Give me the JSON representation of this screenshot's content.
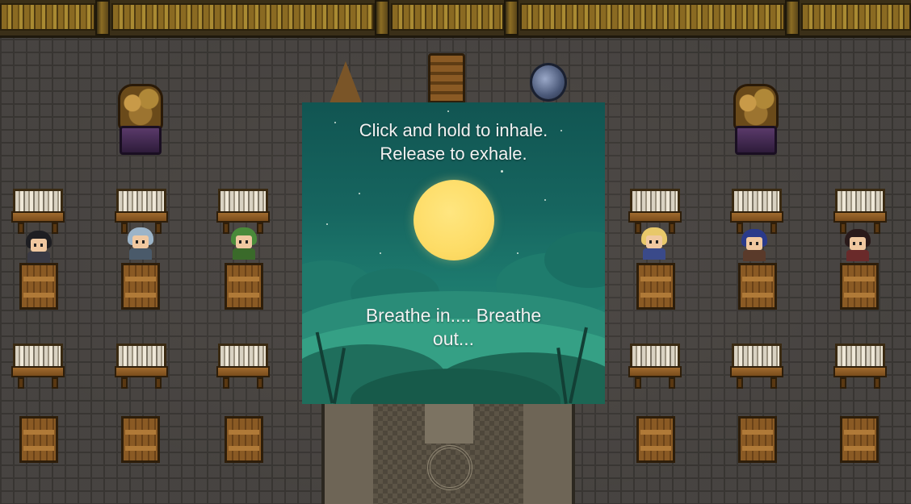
{
  "scene": {
    "name": "classroom",
    "colors": {
      "floor": "#4b4744",
      "wall_gold": "#8a6a22",
      "popup_top": "#115552",
      "popup_bottom": "#289078",
      "moon": "#fddc66",
      "text": "#f2f2f2"
    }
  },
  "breathing_popup": {
    "instruction_line1": "Click and hold to inhale.",
    "instruction_line2": "Release to exhale.",
    "status": "Breathe in.... Breathe out..."
  },
  "students": [
    {
      "name": "student-dark-hair-left",
      "hair": "#1e1e22",
      "body": "#3a3a44"
    },
    {
      "name": "student-silver-hair",
      "hair": "#9cb4c8",
      "body": "#4a5a6a"
    },
    {
      "name": "student-green-cap",
      "hair": "#4a8a3a",
      "body": "#3a6a2a"
    },
    {
      "name": "student-blonde",
      "hair": "#e8c86a",
      "body": "#3a4a8a"
    },
    {
      "name": "student-blue-hat",
      "hair": "#2a3a8a",
      "body": "#5a3a2a"
    },
    {
      "name": "student-dark-hair-right",
      "hair": "#2a1a1a",
      "body": "#6a2a2a"
    }
  ],
  "icons": [
    "statue-icon",
    "throne-icon",
    "globe-icon",
    "moon-icon"
  ]
}
